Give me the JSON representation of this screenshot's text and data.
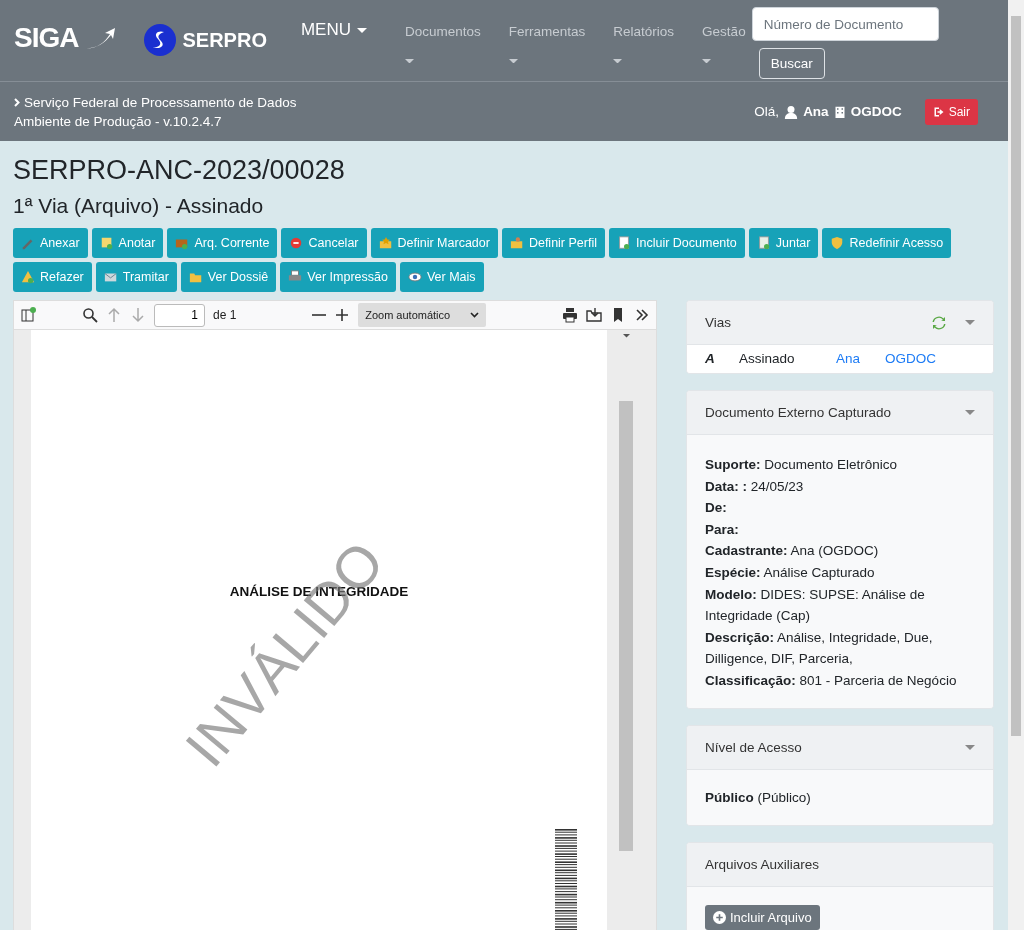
{
  "header": {
    "logo": "SIGA",
    "brand": "SERPRO",
    "menu": "MENU",
    "nav": [
      "Documentos",
      "Ferramentas",
      "Relatórios",
      "Gestão"
    ],
    "search": {
      "placeholder": "Número de Documento"
    },
    "search_button": "Buscar"
  },
  "subheader": {
    "organization": "Serviço Federal de Processamento de Dados",
    "environment": "Ambiente de Produção - v.10.2.4.7",
    "greeting": "Olá,",
    "user": "Ana",
    "unit": "OGDOC",
    "logout": "Sair"
  },
  "title": "SERPRO-ANC-2023/00028",
  "subtitle": "1ª Via (Arquivo) - Assinado",
  "actions": [
    "Anexar",
    "Anotar",
    "Arq. Corrente",
    "Cancelar",
    "Definir Marcador",
    "Definir Perfil",
    "Incluir Documento",
    "Juntar",
    "Redefinir Acesso",
    "Refazer",
    "Tramitar",
    "Ver Dossiê",
    "Ver Impressão",
    "Ver Mais"
  ],
  "pdf_viewer": {
    "page": "1",
    "page_count": "de 1",
    "zoom": "Zoom automático",
    "heading": "ANÁLISE DE INTEGRIDADE",
    "stamp": "INVÁLIDO"
  },
  "panels": [
    {
      "kind": "vias",
      "title": "Vias",
      "rows": [
        {
          "mark": "A",
          "status": "Assinado",
          "user": "Ana",
          "unit": "OGDOC"
        }
      ]
    },
    {
      "kind": "fields",
      "title": "Documento Externo Capturado",
      "fields": [
        {
          "label": "Suporte:",
          "value": "Documento Eletrônico"
        },
        {
          "label": "Data: :",
          "value": "24/05/23"
        },
        {
          "label": "De:"
        },
        {
          "label": "Para:"
        },
        {
          "label": "Cadastrante:",
          "value": "Ana (OGDOC)"
        },
        {
          "label": "Espécie:",
          "value": "Análise Capturado"
        },
        {
          "label": "Modelo:",
          "value": "DIDES: SUPSE: Análise de Integridade (Cap)"
        },
        {
          "label": "Descrição:",
          "value": "Análise, Integridade, Due, Dilligence, DIF, Parceria,"
        },
        {
          "label": "Classificação:",
          "value": "801 - Parceria de Negócio"
        }
      ]
    },
    {
      "kind": "access",
      "title": "Nível de Acesso",
      "level": "Público",
      "detail": "(Público)"
    },
    {
      "kind": "files",
      "title": "Arquivos Auxiliares",
      "button": "Incluir Arquivo"
    }
  ]
}
